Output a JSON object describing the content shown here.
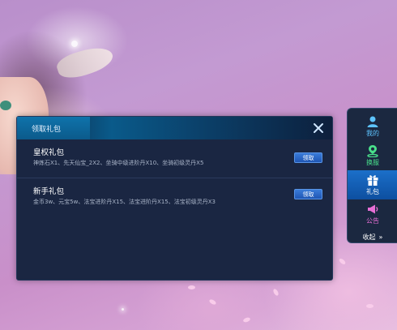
{
  "dialog": {
    "tab_label": "领取礼包",
    "close_icon": "close-x-icon",
    "gifts": [
      {
        "title": "皇权礼包",
        "desc": "神炼石X1、先天仙宝_2X2、坐骑中级进阶丹X10、坐骑初级灵丹X5",
        "button": "领取"
      },
      {
        "title": "新手礼包",
        "desc": "金币3w、元宝5w、法宝进阶丹X15、法宝进阶丹X15、法宝初级灵丹X3",
        "button": "领取"
      }
    ]
  },
  "side_menu": {
    "items": [
      {
        "label": "我的",
        "icon": "user-icon",
        "color": "#5ec4ff"
      },
      {
        "label": "换服",
        "icon": "location-pin-icon",
        "color": "#49e08b"
      },
      {
        "label": "礼包",
        "icon": "gift-icon",
        "color": "#ffffff",
        "active": true
      },
      {
        "label": "公告",
        "icon": "megaphone-icon",
        "color": "#e86fd6"
      }
    ],
    "collapse_label": "收起",
    "collapse_icon": "double-chevron-right-icon"
  }
}
